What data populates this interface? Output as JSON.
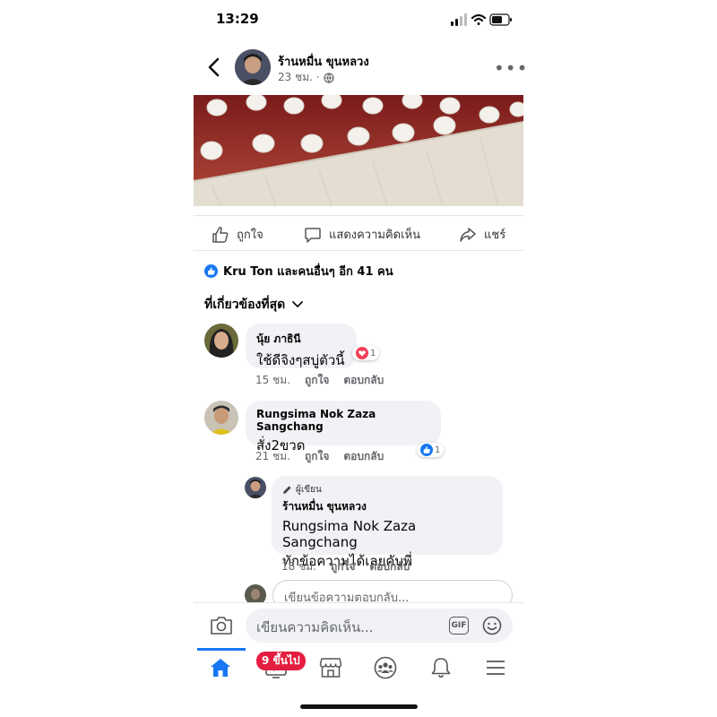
{
  "status_bar": {
    "time": "13:29"
  },
  "post": {
    "page_name": "ร้านหมื่น ขุนหลวง",
    "time": "23 ชม. ·",
    "actions": {
      "like": "ถูกใจ",
      "comment": "แสดงความคิดเห็น",
      "share": "แชร์"
    },
    "reactions_text": "Kru Ton และคนอื่นๆ อีก 41 คน"
  },
  "comments_filter": "ที่เกี่ยวข้องที่สุด",
  "comments": [
    {
      "name": "นุ้ย ภาธินี",
      "text": "ใช้ดีจิงๆสบู่ตัวนี้",
      "reaction": "heart",
      "reaction_count": "1",
      "time": "15 ชม.",
      "like": "ถูกใจ",
      "reply": "ตอบกลับ"
    },
    {
      "name": "Rungsima Nok Zaza Sangchang",
      "text": "สั่ง2ขวด",
      "reaction": "like",
      "reaction_count": "1",
      "time": "21 ชม.",
      "like": "ถูกใจ",
      "reply": "ตอบกลับ"
    }
  ],
  "reply": {
    "author_tag": "ผู้เขียน",
    "name": "ร้านหมื่น ขุนหลวง",
    "mention": "Rungsima Nok Zaza Sangchang",
    "text": "ทักข้อความได้เลยคับพี่",
    "time": "18 ชม.",
    "like": "ถูกใจ",
    "reply": "ตอบกลับ"
  },
  "reply_input_placeholder": "เขียนข้อความตอบกลับ...",
  "composer": {
    "placeholder": "เขียนความคิดเห็น...",
    "gif": "GIF"
  },
  "tabbar": {
    "video_badge": "9 ขึ้นไป"
  },
  "colors": {
    "accent": "#1877f2",
    "badge": "#e41e3f",
    "heart": "#f33e58"
  }
}
